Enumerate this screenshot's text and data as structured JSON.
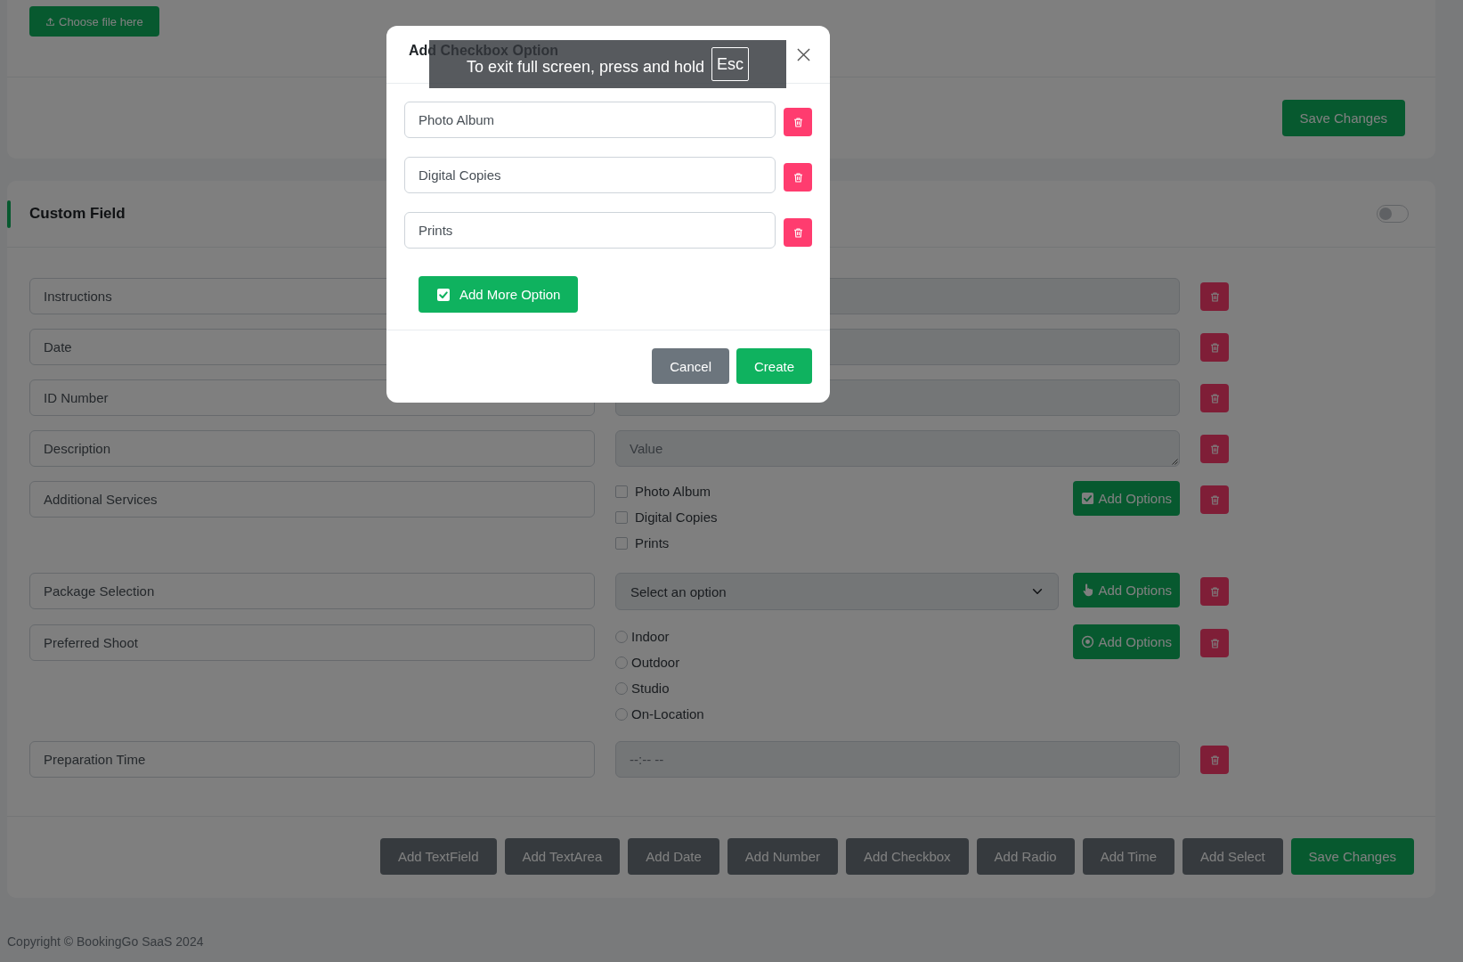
{
  "upload_card": {
    "choose_file_button": "Choose file here",
    "save_button": "Save Changes"
  },
  "custom_field_card": {
    "title": "Custom Field",
    "toggle": {
      "on": false
    },
    "rows": [
      {
        "kind": "field",
        "label": "Instructions"
      },
      {
        "kind": "field",
        "label": "Date"
      },
      {
        "kind": "field",
        "label": "ID Number"
      },
      {
        "kind": "textarea",
        "label": "Description",
        "placeholder": "Value"
      },
      {
        "kind": "checkbox",
        "label": "Additional Services",
        "options": [
          {
            "label": "Photo Album",
            "checked": false
          },
          {
            "label": "Digital Copies",
            "checked": false
          },
          {
            "label": "Prints",
            "checked": false
          }
        ],
        "button": "Add Options"
      },
      {
        "kind": "select",
        "label": "Package Selection",
        "value": "Select an option",
        "button": "Add Options"
      },
      {
        "kind": "radio",
        "label": "Preferred Shoot",
        "options": [
          {
            "label": "Indoor",
            "selected": false
          },
          {
            "label": "Outdoor",
            "selected": false
          },
          {
            "label": "Studio",
            "selected": false
          },
          {
            "label": "On-Location",
            "selected": false
          }
        ],
        "button": "Add Options"
      },
      {
        "kind": "time",
        "label": "Preparation Time",
        "placeholder": "--:-- --"
      }
    ],
    "add_buttons": [
      {
        "label": "Add TextField",
        "kind": "secondary"
      },
      {
        "label": "Add TextArea",
        "kind": "secondary"
      },
      {
        "label": "Add Date",
        "kind": "secondary"
      },
      {
        "label": "Add Number",
        "kind": "secondary"
      },
      {
        "label": "Add Checkbox",
        "kind": "secondary"
      },
      {
        "label": "Add Radio",
        "kind": "secondary"
      },
      {
        "label": "Add Time",
        "kind": "secondary"
      },
      {
        "label": "Add Select",
        "kind": "secondary"
      },
      {
        "label": "Save Changes",
        "kind": "primary"
      }
    ]
  },
  "footer": {
    "copyright": "Copyright © BookingGo SaaS 2024"
  },
  "modal": {
    "title": "Add Checkbox Option",
    "options": [
      "Photo Album",
      "Digital Copies",
      "Prints"
    ],
    "add_more_button": "Add More Option",
    "buttons": [
      {
        "label": "Cancel",
        "kind": "secondary"
      },
      {
        "label": "Create",
        "kind": "primary"
      }
    ]
  },
  "fullscreen_notice": {
    "text": "To exit full screen, press and hold",
    "key": "Esc"
  }
}
